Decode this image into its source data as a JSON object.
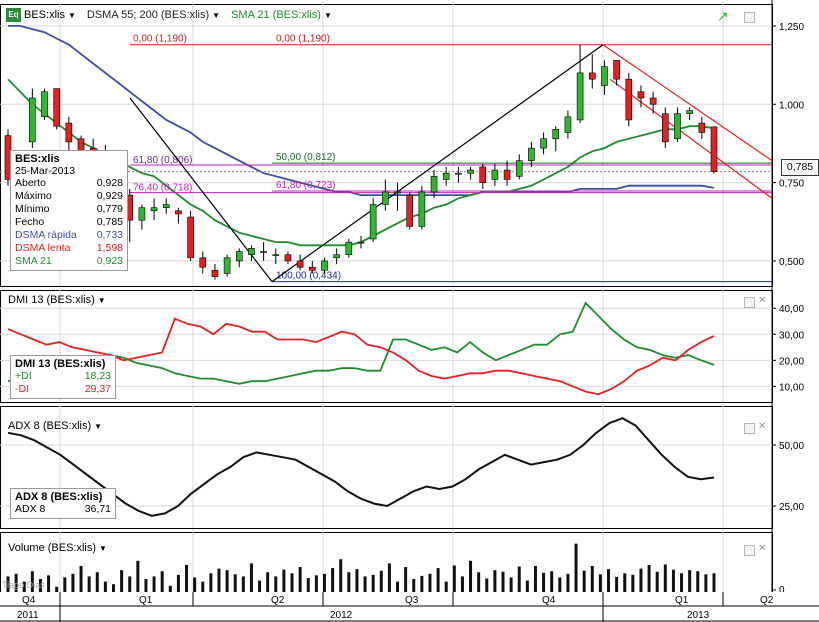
{
  "colors": {
    "grid": "#d8d8d8",
    "up": "#2db82d",
    "down": "#e52020",
    "dsma_fast": "#3c4fa0",
    "sma21": "#1e8c2b",
    "fib_red": "#c81e1e",
    "fib_magenta": "#c61cc6",
    "fib_navy": "#1f2aa0",
    "adx": "#111111",
    "volume": "#111111",
    "plus_di": "#1e8c2b",
    "minus_di": "#e52020",
    "channel": "#e52020"
  },
  "header": {
    "symbol": "BES:xlis",
    "dsma": "DSMA 55; 200 (BES:xlis)",
    "sma": "SMA 21 (BES:xlis)",
    "app_icon": "Eq"
  },
  "info": {
    "title": "BES:xlis",
    "date": "25-Mar-2013",
    "rows": [
      {
        "label": "Aberto",
        "value": "0,928"
      },
      {
        "label": "Máximo",
        "value": "0,929"
      },
      {
        "label": "Mínimo",
        "value": "0,779"
      },
      {
        "label": "Fecho",
        "value": "0,785"
      },
      {
        "label": "DSMA rápida",
        "value": "0,733"
      },
      {
        "label": "DSMA lenta",
        "value": "1,598"
      },
      {
        "label": "SMA 21",
        "value": "0,923"
      }
    ]
  },
  "last_price": "0,785",
  "dmi": {
    "title": "DMI 13 (BES:xlis)",
    "plus_label": "+DI",
    "plus_value": "18,23",
    "minus_label": "-DI",
    "minus_value": "29,37"
  },
  "adx": {
    "title": "ADX 8 (BES:xlis)",
    "label": "ADX 8",
    "value": "36,71"
  },
  "volume": {
    "title": "Volume (BES:xlis)"
  },
  "watermark": "Tiago Dias",
  "axis": {
    "quarters": [
      "Q4",
      "Q1",
      "Q2",
      "Q3",
      "Q4",
      "Q1",
      "Q2"
    ],
    "years": [
      "2011",
      "2012",
      "2013"
    ]
  },
  "chart_data": [
    {
      "type": "candlestick",
      "title": "BES:xlis",
      "ylim": [
        0.42,
        1.32
      ],
      "y_ticks": [
        "1,250",
        "1,000",
        "0,750",
        "0,500"
      ],
      "candles": [
        {
          "o": 0.9,
          "h": 0.92,
          "l": 0.74,
          "c": 0.76
        },
        {
          "o": 0.77,
          "h": 0.8,
          "l": 0.73,
          "c": 0.79
        },
        {
          "o": 0.88,
          "h": 1.05,
          "l": 0.86,
          "c": 1.02
        },
        {
          "o": 0.96,
          "h": 1.05,
          "l": 0.95,
          "c": 1.04
        },
        {
          "o": 1.05,
          "h": 1.05,
          "l": 0.92,
          "c": 0.93
        },
        {
          "o": 0.94,
          "h": 0.96,
          "l": 0.85,
          "c": 0.88
        },
        {
          "o": 0.89,
          "h": 0.9,
          "l": 0.82,
          "c": 0.85
        },
        {
          "o": 0.86,
          "h": 0.89,
          "l": 0.8,
          "c": 0.82
        },
        {
          "o": 0.84,
          "h": 0.87,
          "l": 0.76,
          "c": 0.81
        },
        {
          "o": 0.8,
          "h": 0.82,
          "l": 0.7,
          "c": 0.7
        },
        {
          "o": 0.71,
          "h": 0.73,
          "l": 0.56,
          "c": 0.63
        },
        {
          "o": 0.63,
          "h": 0.68,
          "l": 0.6,
          "c": 0.67
        },
        {
          "o": 0.66,
          "h": 0.7,
          "l": 0.63,
          "c": 0.67
        },
        {
          "o": 0.67,
          "h": 0.7,
          "l": 0.65,
          "c": 0.68
        },
        {
          "o": 0.66,
          "h": 0.67,
          "l": 0.62,
          "c": 0.65
        },
        {
          "o": 0.64,
          "h": 0.66,
          "l": 0.5,
          "c": 0.51
        },
        {
          "o": 0.51,
          "h": 0.53,
          "l": 0.46,
          "c": 0.48
        },
        {
          "o": 0.47,
          "h": 0.49,
          "l": 0.44,
          "c": 0.45
        },
        {
          "o": 0.46,
          "h": 0.52,
          "l": 0.45,
          "c": 0.51
        },
        {
          "o": 0.5,
          "h": 0.54,
          "l": 0.48,
          "c": 0.53
        },
        {
          "o": 0.52,
          "h": 0.55,
          "l": 0.5,
          "c": 0.54
        },
        {
          "o": 0.53,
          "h": 0.56,
          "l": 0.5,
          "c": 0.53
        },
        {
          "o": 0.52,
          "h": 0.54,
          "l": 0.49,
          "c": 0.52
        },
        {
          "o": 0.52,
          "h": 0.53,
          "l": 0.49,
          "c": 0.5
        },
        {
          "o": 0.5,
          "h": 0.52,
          "l": 0.47,
          "c": 0.48
        },
        {
          "o": 0.48,
          "h": 0.5,
          "l": 0.46,
          "c": 0.47
        },
        {
          "o": 0.47,
          "h": 0.51,
          "l": 0.46,
          "c": 0.5
        },
        {
          "o": 0.51,
          "h": 0.54,
          "l": 0.49,
          "c": 0.52
        },
        {
          "o": 0.52,
          "h": 0.57,
          "l": 0.51,
          "c": 0.56
        },
        {
          "o": 0.56,
          "h": 0.58,
          "l": 0.54,
          "c": 0.56
        },
        {
          "o": 0.57,
          "h": 0.7,
          "l": 0.56,
          "c": 0.68
        },
        {
          "o": 0.68,
          "h": 0.76,
          "l": 0.66,
          "c": 0.72
        },
        {
          "o": 0.72,
          "h": 0.75,
          "l": 0.66,
          "c": 0.72
        },
        {
          "o": 0.71,
          "h": 0.72,
          "l": 0.6,
          "c": 0.61
        },
        {
          "o": 0.61,
          "h": 0.74,
          "l": 0.6,
          "c": 0.72
        },
        {
          "o": 0.72,
          "h": 0.79,
          "l": 0.7,
          "c": 0.77
        },
        {
          "o": 0.76,
          "h": 0.8,
          "l": 0.74,
          "c": 0.78
        },
        {
          "o": 0.78,
          "h": 0.8,
          "l": 0.75,
          "c": 0.78
        },
        {
          "o": 0.78,
          "h": 0.8,
          "l": 0.76,
          "c": 0.79
        },
        {
          "o": 0.8,
          "h": 0.81,
          "l": 0.73,
          "c": 0.75
        },
        {
          "o": 0.76,
          "h": 0.81,
          "l": 0.74,
          "c": 0.79
        },
        {
          "o": 0.79,
          "h": 0.82,
          "l": 0.74,
          "c": 0.76
        },
        {
          "o": 0.77,
          "h": 0.84,
          "l": 0.76,
          "c": 0.82
        },
        {
          "o": 0.82,
          "h": 0.88,
          "l": 0.8,
          "c": 0.86
        },
        {
          "o": 0.86,
          "h": 0.91,
          "l": 0.84,
          "c": 0.89
        },
        {
          "o": 0.89,
          "h": 0.93,
          "l": 0.85,
          "c": 0.92
        },
        {
          "o": 0.91,
          "h": 0.98,
          "l": 0.89,
          "c": 0.96
        },
        {
          "o": 0.95,
          "h": 1.19,
          "l": 0.94,
          "c": 1.1
        },
        {
          "o": 1.1,
          "h": 1.16,
          "l": 1.05,
          "c": 1.08
        },
        {
          "o": 1.06,
          "h": 1.14,
          "l": 1.03,
          "c": 1.12
        },
        {
          "o": 1.14,
          "h": 1.14,
          "l": 1.06,
          "c": 1.08
        },
        {
          "o": 1.08,
          "h": 1.1,
          "l": 0.93,
          "c": 0.95
        },
        {
          "o": 1.04,
          "h": 1.06,
          "l": 0.99,
          "c": 1.02
        },
        {
          "o": 1.02,
          "h": 1.04,
          "l": 0.97,
          "c": 1.0
        },
        {
          "o": 0.97,
          "h": 0.99,
          "l": 0.86,
          "c": 0.88
        },
        {
          "o": 0.89,
          "h": 0.99,
          "l": 0.88,
          "c": 0.97
        },
        {
          "o": 0.97,
          "h": 0.99,
          "l": 0.95,
          "c": 0.98
        },
        {
          "o": 0.94,
          "h": 0.96,
          "l": 0.89,
          "c": 0.91
        },
        {
          "o": 0.928,
          "h": 0.929,
          "l": 0.779,
          "c": 0.785
        }
      ],
      "sma21": [
        1.08,
        1.04,
        1.0,
        0.97,
        0.94,
        0.91,
        0.88,
        0.86,
        0.84,
        0.82,
        0.8,
        0.78,
        0.77,
        0.74,
        0.71,
        0.68,
        0.66,
        0.63,
        0.61,
        0.59,
        0.58,
        0.57,
        0.56,
        0.56,
        0.55,
        0.55,
        0.55,
        0.55,
        0.55,
        0.56,
        0.58,
        0.6,
        0.62,
        0.64,
        0.65,
        0.67,
        0.68,
        0.7,
        0.71,
        0.72,
        0.72,
        0.72,
        0.73,
        0.74,
        0.76,
        0.78,
        0.8,
        0.83,
        0.85,
        0.86,
        0.88,
        0.89,
        0.9,
        0.91,
        0.92,
        0.92,
        0.93,
        0.93,
        0.923
      ],
      "dsma_fast": [
        1.25,
        1.25,
        1.24,
        1.23,
        1.21,
        1.19,
        1.16,
        1.13,
        1.1,
        1.07,
        1.04,
        1.01,
        0.98,
        0.95,
        0.93,
        0.91,
        0.88,
        0.86,
        0.84,
        0.82,
        0.8,
        0.78,
        0.77,
        0.76,
        0.75,
        0.74,
        0.73,
        0.72,
        0.72,
        0.71,
        0.71,
        0.71,
        0.71,
        0.71,
        0.71,
        0.71,
        0.71,
        0.71,
        0.71,
        0.72,
        0.72,
        0.72,
        0.72,
        0.72,
        0.72,
        0.72,
        0.72,
        0.73,
        0.73,
        0.73,
        0.73,
        0.74,
        0.74,
        0.74,
        0.74,
        0.74,
        0.74,
        0.74,
        0.733
      ],
      "fib_left": [
        {
          "label": "0,00 (1,190)",
          "value": 1.19
        },
        {
          "label": "61,80 (0,806)",
          "value": 0.806
        },
        {
          "label": "76,40 (0,718)",
          "value": 0.718
        }
      ],
      "fib_right": [
        {
          "label": "0,00 (1,190)",
          "value": 1.19
        },
        {
          "label": "50,00 (0,812)",
          "value": 0.812
        },
        {
          "label": "61,80 (0,723)",
          "value": 0.723
        },
        {
          "label": "100,00 (0,434)",
          "value": 0.434
        }
      ]
    },
    {
      "type": "line",
      "title": "DMI 13 (BES:xlis)",
      "ylim": [
        4,
        47
      ],
      "y_ticks": [
        "40,00",
        "30,00",
        "20,00",
        "10,00"
      ],
      "series": [
        {
          "name": "+DI",
          "values": [
            12,
            13,
            15,
            16,
            17,
            18,
            19,
            21,
            22,
            21,
            19,
            18,
            17,
            15,
            14,
            13,
            13,
            12,
            11,
            12,
            12,
            13,
            14,
            15,
            16,
            16,
            17,
            17,
            16,
            16,
            28,
            28,
            26,
            24,
            25,
            23,
            27,
            23,
            20,
            22,
            24,
            26,
            26,
            30,
            31,
            42,
            37,
            32,
            28,
            25,
            24,
            22,
            21,
            22,
            20,
            18.23
          ]
        },
        {
          "name": "-DI",
          "values": [
            32,
            30,
            28,
            26,
            27,
            25,
            24,
            23,
            22,
            20,
            21,
            22,
            23,
            36,
            34,
            33,
            30,
            34,
            33,
            31,
            31,
            28,
            28,
            28,
            27,
            29,
            31,
            30,
            26,
            25,
            23,
            20,
            16,
            14,
            13,
            14,
            15,
            15,
            16,
            16,
            15,
            14,
            13,
            12,
            10,
            8,
            7,
            9,
            12,
            16,
            18,
            21,
            20,
            24,
            27,
            29.37
          ]
        }
      ]
    },
    {
      "type": "line",
      "title": "ADX 8 (BES:xlis)",
      "ylim": [
        16,
        66
      ],
      "y_ticks": [
        "50,00",
        "25,00"
      ],
      "series": [
        {
          "name": "ADX 8",
          "values": [
            55,
            54,
            52,
            49,
            46,
            42,
            38,
            34,
            30,
            26,
            23,
            21,
            22,
            25,
            30,
            34,
            38,
            41,
            45,
            47,
            46,
            45,
            44,
            41,
            38,
            35,
            31,
            28,
            26,
            25,
            28,
            31,
            33,
            32,
            33,
            36,
            40,
            43,
            46,
            44,
            42,
            43,
            44,
            46,
            50,
            55,
            59,
            61,
            58,
            52,
            46,
            41,
            37,
            36,
            36.71
          ]
        }
      ]
    },
    {
      "type": "bar",
      "title": "Volume (BES:xlis)",
      "ylim": [
        0,
        10
      ],
      "y_ticks": [
        "0"
      ],
      "values": [
        3.0,
        3.5,
        2.0,
        4.0,
        2.5,
        3.2,
        1.0,
        2.8,
        3.5,
        5.0,
        3.0,
        3.8,
        2.0,
        1.5,
        4.2,
        3.0,
        6.0,
        2.5,
        3.0,
        4.0,
        1.2,
        3.3,
        5.2,
        2.8,
        2.0,
        3.6,
        4.5,
        4.2,
        3.4,
        3.0,
        5.5,
        2.2,
        3.8,
        3.0,
        4.3,
        3.6,
        4.8,
        2.7,
        3.2,
        3.5,
        4.6,
        6.3,
        3.8,
        4.4,
        3.0,
        3.3,
        4.1,
        5.5,
        2.0,
        4.8,
        2.5,
        3.1,
        3.5,
        4.6,
        2.0,
        5.1,
        3.0,
        6.0,
        3.8,
        2.6,
        4.2,
        3.9,
        2.8,
        4.9,
        2.2,
        5.0,
        3.7,
        4.0,
        2.8,
        3.5,
        9.3,
        4.1,
        5.0,
        3.4,
        4.4,
        2.9,
        3.6,
        3.3,
        4.5,
        5.2,
        3.9,
        5.3,
        4.3,
        3.6,
        4.2,
        4.0,
        3.4,
        3.6
      ]
    }
  ]
}
